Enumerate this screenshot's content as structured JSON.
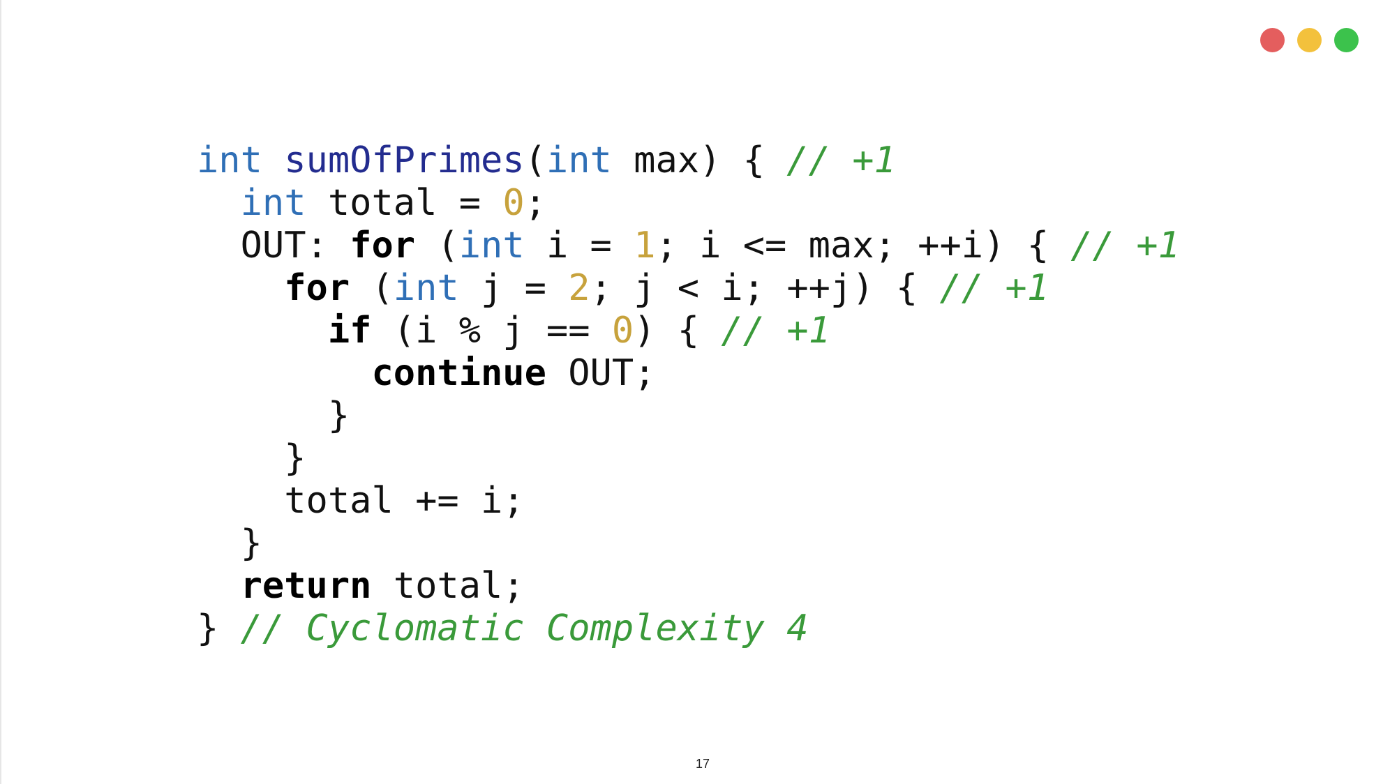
{
  "window_controls": {
    "colors": [
      "#e45e5e",
      "#f3c13c",
      "#3cc24c"
    ]
  },
  "code": {
    "line1": {
      "type1": "int",
      "fn": "sumOfPrimes",
      "paren_open": "(",
      "type2": "int",
      "rest": " max) { ",
      "comment": "// +1"
    },
    "line2": {
      "indent": "  ",
      "type": "int",
      "mid": " total = ",
      "num": "0",
      "end": ";"
    },
    "line3": {
      "indent": "  ",
      "label": "OUT: ",
      "kw": "for",
      "paren": " (",
      "type": "int",
      "mid": " i = ",
      "num": "1",
      "rest": "; i <= max; ++i) { ",
      "comment": "// +1"
    },
    "line4": {
      "indent": "    ",
      "kw": "for",
      "paren": " (",
      "type": "int",
      "mid": " j = ",
      "num": "2",
      "rest": "; j < i; ++j) { ",
      "comment": "// +1"
    },
    "line5": {
      "indent": "      ",
      "kw": "if",
      "mid": " (i % j == ",
      "num": "0",
      "rest": ") { ",
      "comment": "// +1"
    },
    "line6": {
      "indent": "        ",
      "kw": "continue",
      "rest": " OUT;"
    },
    "line7": {
      "text": "      }"
    },
    "line8": {
      "text": "    }"
    },
    "line9": {
      "text": "    total += i;"
    },
    "line10": {
      "text": "  }"
    },
    "line11": {
      "indent": "  ",
      "kw": "return",
      "rest": " total;"
    },
    "line12": {
      "brace": "} ",
      "comment": "// Cyclomatic Complexity 4"
    }
  },
  "footer": {
    "page_number": "17"
  }
}
